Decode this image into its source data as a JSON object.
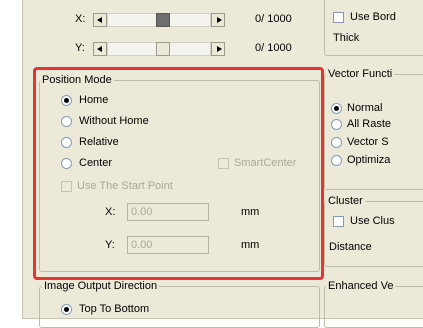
{
  "sliders": {
    "x": {
      "label": "X:",
      "value_text": "0/ 1000"
    },
    "y": {
      "label": "Y:",
      "value_text": "0/ 1000"
    }
  },
  "right_top": {
    "use_border_label": "Use Bord",
    "thick_label": "Thick"
  },
  "position_mode": {
    "legend": "Position Mode",
    "options": [
      {
        "label": "Home",
        "checked": true
      },
      {
        "label": "Without Home",
        "checked": false
      },
      {
        "label": "Relative",
        "checked": false
      },
      {
        "label": "Center",
        "checked": false
      }
    ],
    "smart_center_label": "SmartCenter",
    "use_start_point_label": "Use The Start Point",
    "x_label": "X:",
    "x_value": "0.00",
    "y_label": "Y:",
    "y_value": "0.00",
    "unit": "mm"
  },
  "vector_function": {
    "legend": "Vector Functi",
    "options": [
      {
        "label": "Normal",
        "checked": true
      },
      {
        "label": "All Raste",
        "checked": false
      },
      {
        "label": "Vector S",
        "checked": false
      },
      {
        "label": "Optimiza",
        "checked": false
      }
    ]
  },
  "cluster": {
    "legend": "Cluster",
    "use_cluster_label": "Use Clus",
    "distance_label": "Distance"
  },
  "image_output": {
    "legend": "Image Output Direction",
    "option_label": "Top To Bottom"
  },
  "enhanced": {
    "legend": "Enhanced Ve"
  },
  "colors": {
    "highlight": "#e03830",
    "dialog_bg": "#ece9d8"
  }
}
